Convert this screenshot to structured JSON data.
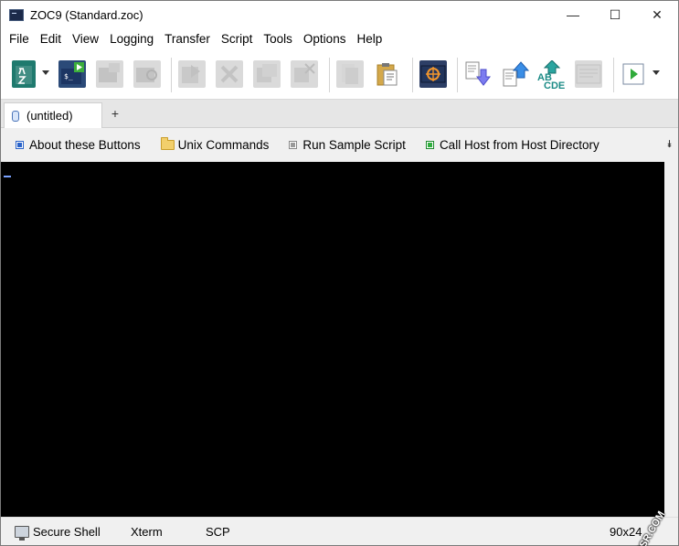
{
  "window": {
    "title": "ZOC9 (Standard.zoc)"
  },
  "controls": {
    "minimize": "—",
    "maximize": "☐",
    "close": "✕"
  },
  "menu": [
    "File",
    "Edit",
    "View",
    "Logging",
    "Transfer",
    "Script",
    "Tools",
    "Options",
    "Help"
  ],
  "toolbar": {
    "icons": [
      "host-directory-icon",
      "quick-connect-icon",
      "new-session-icon",
      "reconnect-icon",
      "send-file-icon",
      "disconnect-icon",
      "copy-icon",
      "close-session-icon",
      "notes-icon",
      "paste-icon",
      "capture-icon",
      "download-icon",
      "upload-icon",
      "translation-icon",
      "screen-icon",
      "run-script-icon"
    ],
    "abcde_label": "AB",
    "cde_label": "CDE"
  },
  "tab": {
    "label": "(untitled)",
    "add": "+"
  },
  "buttonbar": {
    "items": [
      "About these Buttons",
      "Unix Commands",
      "Run Sample Script",
      "Call Host from Host Directory"
    ],
    "overflow": "⯯"
  },
  "status": {
    "protocol": "Secure Shell",
    "emulation": "Xterm",
    "transfer": "SCP",
    "size": "90x24"
  },
  "watermark": "OSSR.COM"
}
